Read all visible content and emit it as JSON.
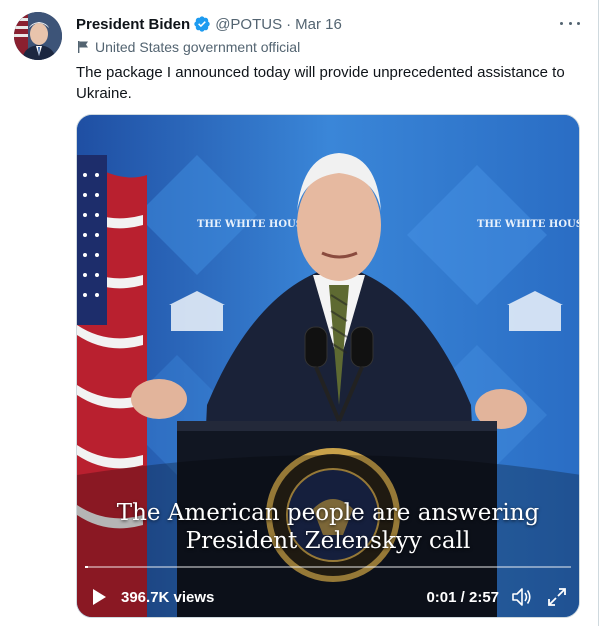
{
  "tweet": {
    "display_name": "President Biden",
    "handle": "@POTUS",
    "separator": "·",
    "date": "Mar 16",
    "label": "United States government official",
    "text": "The package I announced today will provide unprecedented assistance to Ukraine."
  },
  "video": {
    "caption_line1": "The American people are answering",
    "caption_line2": "President Zelenskyy call",
    "backdrop_text": "THE WHITE HOUSE",
    "seal_text": "PRESIDENT OF THE UNITED STATES",
    "views": "396.7K views",
    "time": "0:01 / 2:57",
    "progress": 0.006
  },
  "icons": {
    "verified": "verified-badge-icon",
    "government": "flag-icon",
    "more": "more-icon",
    "play": "play-icon",
    "volume": "volume-icon",
    "fullscreen": "fullscreen-icon"
  },
  "colors": {
    "verified": "#1d9bf0",
    "secondary_text": "#536471",
    "backdrop_blue": "#2c6fc2"
  }
}
